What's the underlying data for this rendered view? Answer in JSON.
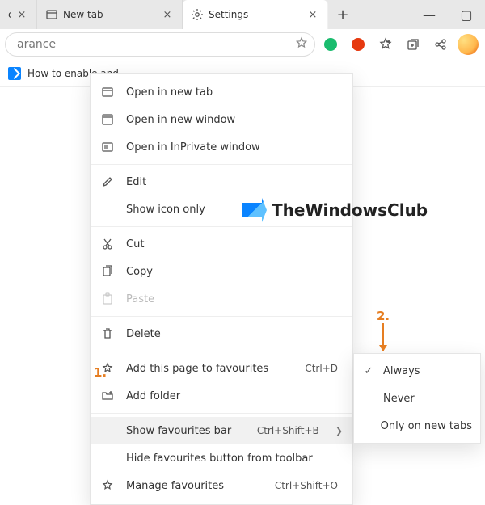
{
  "titlebar": {
    "tabs": [
      {
        "label": "cks, H",
        "icon": "page-icon"
      },
      {
        "label": "New tab",
        "icon": "newtab-icon"
      },
      {
        "label": "Settings",
        "icon": "gear-icon",
        "active": true
      }
    ],
    "new_tab_plus": "+"
  },
  "win": {
    "min": "—",
    "max": "▢"
  },
  "address": {
    "text": "arance",
    "star_icon": "favorite-outline-icon"
  },
  "extensions": {
    "grammarly": "green-circle-icon",
    "opera": "red-circle-icon",
    "fav_menu": "favorites-star-icon",
    "collections": "collections-icon",
    "share": "share-icon",
    "profile": "avatar"
  },
  "favbar": {
    "item_label": "How to enable and..."
  },
  "menu": {
    "open_new_tab": "Open in new tab",
    "open_new_window": "Open in new window",
    "open_inprivate": "Open in InPrivate window",
    "edit": "Edit",
    "show_icon_only": "Show icon only",
    "cut": "Cut",
    "copy": "Copy",
    "paste": "Paste",
    "delete": "Delete",
    "add_page_fav": "Add this page to favourites",
    "add_page_fav_shortcut": "Ctrl+D",
    "add_folder": "Add folder",
    "show_fav_bar": "Show favourites bar",
    "show_fav_bar_shortcut": "Ctrl+Shift+B",
    "hide_fav_button": "Hide favourites button from toolbar",
    "manage_fav": "Manage favourites",
    "manage_fav_shortcut": "Ctrl+Shift+O"
  },
  "submenu": {
    "always": "Always",
    "never": "Never",
    "only_new_tabs": "Only on new tabs"
  },
  "annotations": {
    "one": "1.",
    "two": "2."
  },
  "watermark": "TheWindowsClub"
}
